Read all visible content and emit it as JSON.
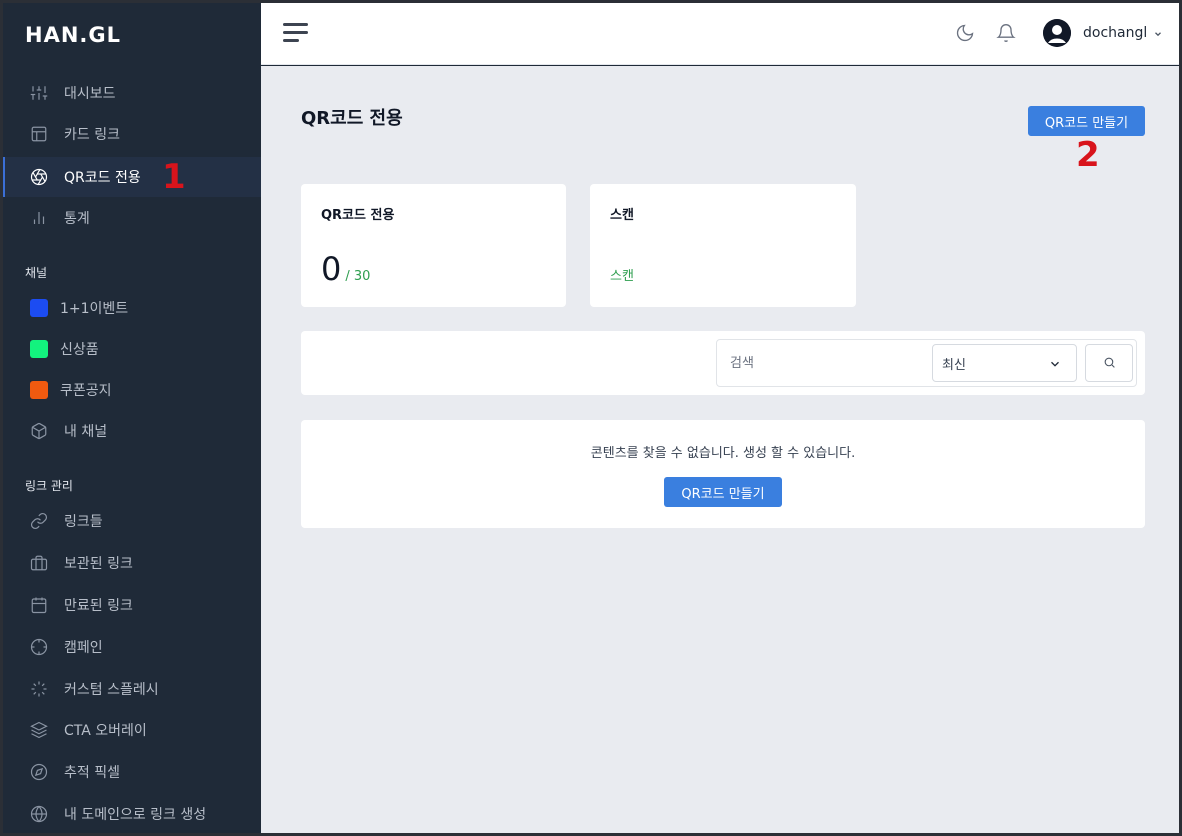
{
  "brand": {
    "logo_text": "HAN.GL"
  },
  "sidebar": {
    "main_items": [
      {
        "label": "대시보드",
        "icon": "sliders-icon"
      },
      {
        "label": "카드 링크",
        "icon": "layout-icon"
      },
      {
        "label": "QR코드 전용",
        "icon": "aperture-icon",
        "active": true
      },
      {
        "label": "통계",
        "icon": "bar-chart-icon"
      }
    ],
    "channels_title": "채널",
    "channels": [
      {
        "label": "1+1이벤트",
        "color": "#1c4cf2"
      },
      {
        "label": "신상품",
        "color": "#13f27e"
      },
      {
        "label": "쿠폰공지",
        "color": "#ef5a10"
      },
      {
        "label": "내 채널",
        "icon": "box-icon"
      }
    ],
    "links_title": "링크 관리",
    "links": [
      {
        "label": "링크들",
        "icon": "link-icon"
      },
      {
        "label": "보관된 링크",
        "icon": "briefcase-icon"
      },
      {
        "label": "만료된 링크",
        "icon": "calendar-icon"
      },
      {
        "label": "캠페인",
        "icon": "crosshair-icon"
      },
      {
        "label": "커스텀 스플레시",
        "icon": "loader-icon"
      },
      {
        "label": "CTA 오버레이",
        "icon": "layers-icon"
      },
      {
        "label": "추적 픽셀",
        "icon": "compass-icon"
      },
      {
        "label": "내 도메인으로 링크 생성",
        "icon": "globe-icon"
      }
    ]
  },
  "annotations": {
    "one": "1",
    "two": "2"
  },
  "header": {
    "username": "dochangl"
  },
  "main": {
    "page_title": "QR코드 전용",
    "create_button": "QR코드 만들기",
    "stats": [
      {
        "title": "QR코드 전용",
        "value": "0",
        "limit": "/ 30"
      },
      {
        "title": "스캔",
        "link": "스캔"
      }
    ],
    "search": {
      "placeholder": "검색",
      "sort_selected": "최신"
    },
    "empty": {
      "message": "콘텐츠를 찾을 수 없습니다. 생성 할 수 있습니다.",
      "button": "QR코드 만들기"
    }
  },
  "colors": {
    "accent": "#3a7fdf",
    "sidebar_bg": "#1f2a38",
    "success": "#2e9e4f",
    "annotation": "#d8141c"
  }
}
